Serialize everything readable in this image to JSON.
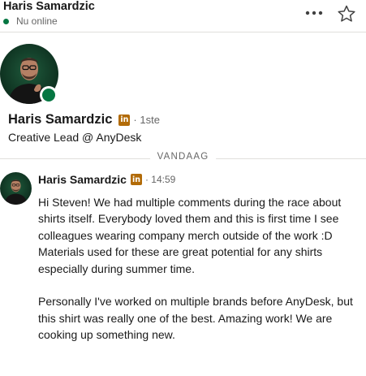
{
  "header": {
    "name": "Haris Samardzic",
    "status": "Nu online",
    "more_icon": "more-horizontal-icon",
    "star_icon": "star-icon"
  },
  "profile": {
    "name": "Haris Samardzic",
    "badge_icon": "linkedin-premium-icon",
    "badge_text": "in",
    "degree": "· 1ste",
    "headline": "Creative Lead @ AnyDesk",
    "online": true
  },
  "divider": {
    "label": "VANDAAG"
  },
  "message": {
    "sender": "Haris Samardzic",
    "badge_text": "in",
    "time": "· 14:59",
    "paragraphs": [
      "Hi Steven! We had multiple comments during the race about shirts itself. Everybody loved them and this is first time I see colleagues wearing company merch outside of the work :D Materials used for these are great potential for any shirts especially during summer time.",
      "Personally I've worked on multiple brands before AnyDesk, but this shirt was really one of the best. Amazing work! We are cooking up something new."
    ]
  },
  "colors": {
    "online_green": "#057642",
    "badge_gold": "#b26b08",
    "text": "#191919",
    "muted": "#666666"
  }
}
